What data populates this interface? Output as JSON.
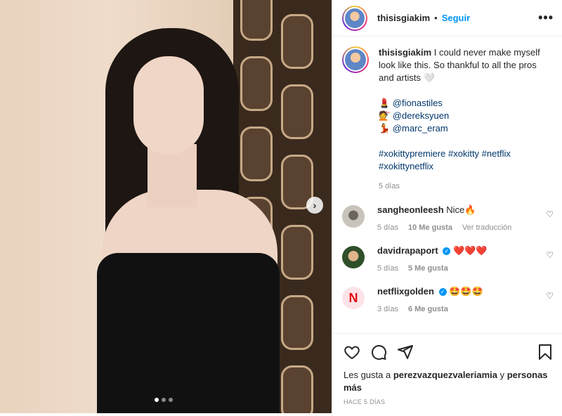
{
  "post": {
    "username": "thisisgiakim",
    "follow_label": "Seguir",
    "separator": "•",
    "more_label": "•••"
  },
  "caption": {
    "username": "thisisgiakim",
    "text": "I could never make myself look like this. So thankful to all the pros and artists 🤍",
    "credits": [
      {
        "emoji": "💄",
        "handle": "@fionastiles"
      },
      {
        "emoji": "💇",
        "handle": "@dereksyuen"
      },
      {
        "emoji": "💃",
        "handle": "@marc_eram"
      }
    ],
    "hashtags_line1": "#xokittypremiere #xokitty #netflix",
    "hashtags_line2": "#xokittynetflix",
    "time": "5 días"
  },
  "comments": [
    {
      "username": "sangheonleesh",
      "verified": false,
      "text": "Nice🔥",
      "time": "5 días",
      "likes": "10 Me gusta",
      "reply": "Ver traducción"
    },
    {
      "username": "davidrapaport",
      "verified": true,
      "text": "❤️❤️❤️",
      "time": "5 días",
      "likes": "5 Me gusta"
    },
    {
      "username": "netflixgolden",
      "verified": true,
      "text": "🤩🤩🤩",
      "time": "3 días",
      "likes": "6 Me gusta"
    }
  ],
  "footer": {
    "likes_prefix": "Les gusta a",
    "liker": "perezvazquezvaleriamia",
    "likes_mid": "y",
    "likes_others": "personas más",
    "date": "HACE 5 DÍAS"
  },
  "carousel": {
    "slides": 3,
    "current": 1,
    "next_icon": "chevron-right-icon"
  },
  "colors": {
    "link": "#0095f6",
    "hashtag": "#00376b",
    "muted": "#8e8e8e"
  }
}
